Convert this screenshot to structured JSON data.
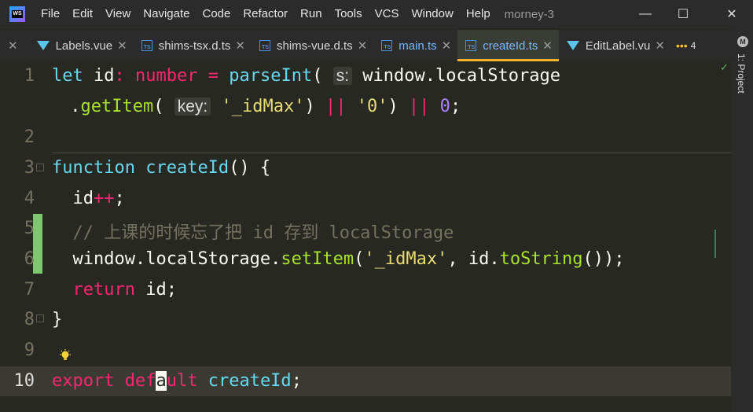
{
  "menubar": {
    "logo_text": "WS",
    "items": [
      "File",
      "Edit",
      "View",
      "Navigate",
      "Code",
      "Refactor",
      "Run",
      "Tools",
      "VCS",
      "Window",
      "Help"
    ],
    "project_name": "morney-3"
  },
  "tabs": [
    {
      "label": "Labels.vue",
      "icon": "vue-icon",
      "active": false
    },
    {
      "label": "shims-tsx.d.ts",
      "icon": "ts-icon",
      "active": false
    },
    {
      "label": "shims-vue.d.ts",
      "icon": "ts-icon",
      "active": false
    },
    {
      "label": "main.ts",
      "icon": "ts-icon",
      "active": false
    },
    {
      "label": "createId.ts",
      "icon": "ts-icon",
      "active": true
    },
    {
      "label": "EditLabel.vu",
      "icon": "vue-icon",
      "active": false
    }
  ],
  "tab_overflow_count": "4",
  "right_toolbar": {
    "project_label": "1: Project",
    "m_icon": "M"
  },
  "editor": {
    "line_numbers": [
      "1",
      "2",
      "3",
      "4",
      "5",
      "6",
      "7",
      "8",
      "9",
      "10"
    ],
    "current_line": "10",
    "line1": {
      "let": "let",
      "id": " id",
      "colon": ": ",
      "type": "number",
      "eq": " = ",
      "fn": "parseInt",
      "paren": "(",
      "hint": "s:",
      "obj": " window.localStorage"
    },
    "line1b": {
      "dot": " .",
      "fn": "getItem",
      "paren": "(",
      "hint": "key:",
      "str1": " '_idMax'",
      "close": ")",
      "or1": " ||",
      "str2": " '0'",
      "close2": ")",
      "or2": " ||",
      "num": " 0",
      "semi": ";"
    },
    "line3": {
      "kw": "function",
      "name": " createId",
      "rest": "() {"
    },
    "line4": {
      "id": "  id",
      "op": "++",
      "semi": ";"
    },
    "line5": {
      "comment": "  // 上课的时候忘了把 id 存到 localStorage"
    },
    "line6": {
      "obj": "  window.localStorage.",
      "fn": "setItem",
      "open": "(",
      "str": "'_idMax'",
      "mid": ", id.",
      "fn2": "toString",
      "end": "());"
    },
    "line7": {
      "kw": "  return",
      "rest": " id;"
    },
    "line8": {
      "brace": "}"
    },
    "line10": {
      "kw1": "export",
      "kw2a": " def",
      "cursor": "a",
      "kw2b": "ult",
      "name": " createId",
      "semi": ";"
    }
  }
}
